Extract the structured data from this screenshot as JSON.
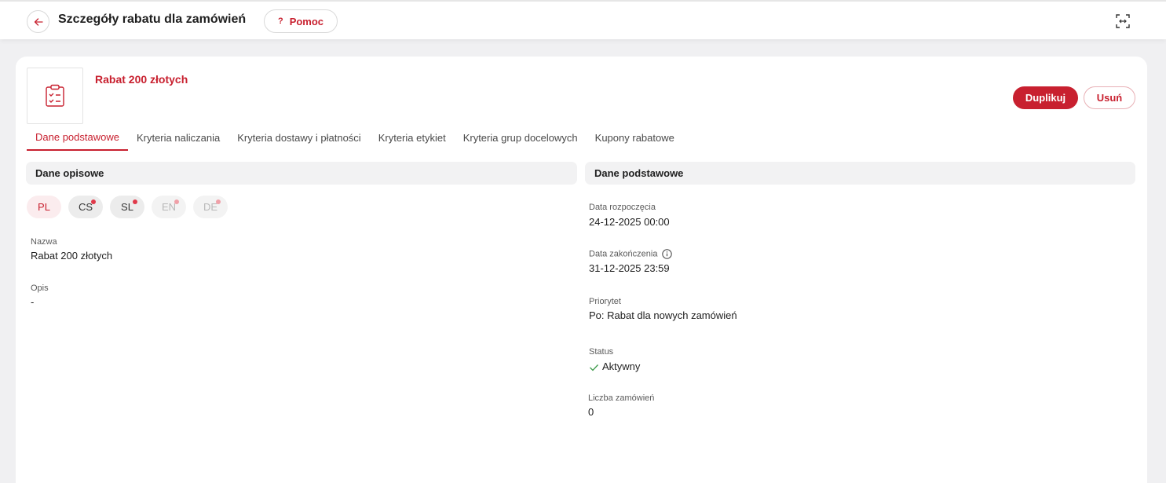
{
  "header": {
    "title": "Szczegóły rabatu dla zamówień",
    "help_label": "Pomoc",
    "help_icon": "?"
  },
  "discount": {
    "name": "Rabat 200 złotych",
    "thumbnail_icon": "clipboard-check-icon"
  },
  "actions": {
    "duplicate_label": "Duplikuj",
    "delete_label": "Usuń"
  },
  "tabs": [
    {
      "label": "Dane podstawowe",
      "active": true
    },
    {
      "label": "Kryteria naliczania"
    },
    {
      "label": "Kryteria dostawy i płatności"
    },
    {
      "label": "Kryteria etykiet"
    },
    {
      "label": "Kryteria grup docelowych"
    },
    {
      "label": "Kupony rabatowe"
    }
  ],
  "left": {
    "section_title": "Dane opisowe",
    "languages": [
      "PL",
      "CS",
      "SL",
      "EN",
      "DE"
    ],
    "name_label": "Nazwa",
    "name_value": "Rabat 200 złotych",
    "desc_label": "Opis",
    "desc_value": "-"
  },
  "right": {
    "section_title": "Dane podstawowe",
    "start_label": "Data rozpoczęcia",
    "start_value": "24-12-2025 00:00",
    "end_label": "Data zakończenia",
    "end_value": "31-12-2025 23:59",
    "priority_label": "Priorytet",
    "priority_value": "Po: Rabat dla nowych zamówień",
    "status_label": "Status",
    "status_value": "Aktywny",
    "orders_label": "Liczba zamówień",
    "orders_value": "0"
  },
  "colors": {
    "accent": "#c8202f",
    "status_ok": "#3c9a4a"
  }
}
